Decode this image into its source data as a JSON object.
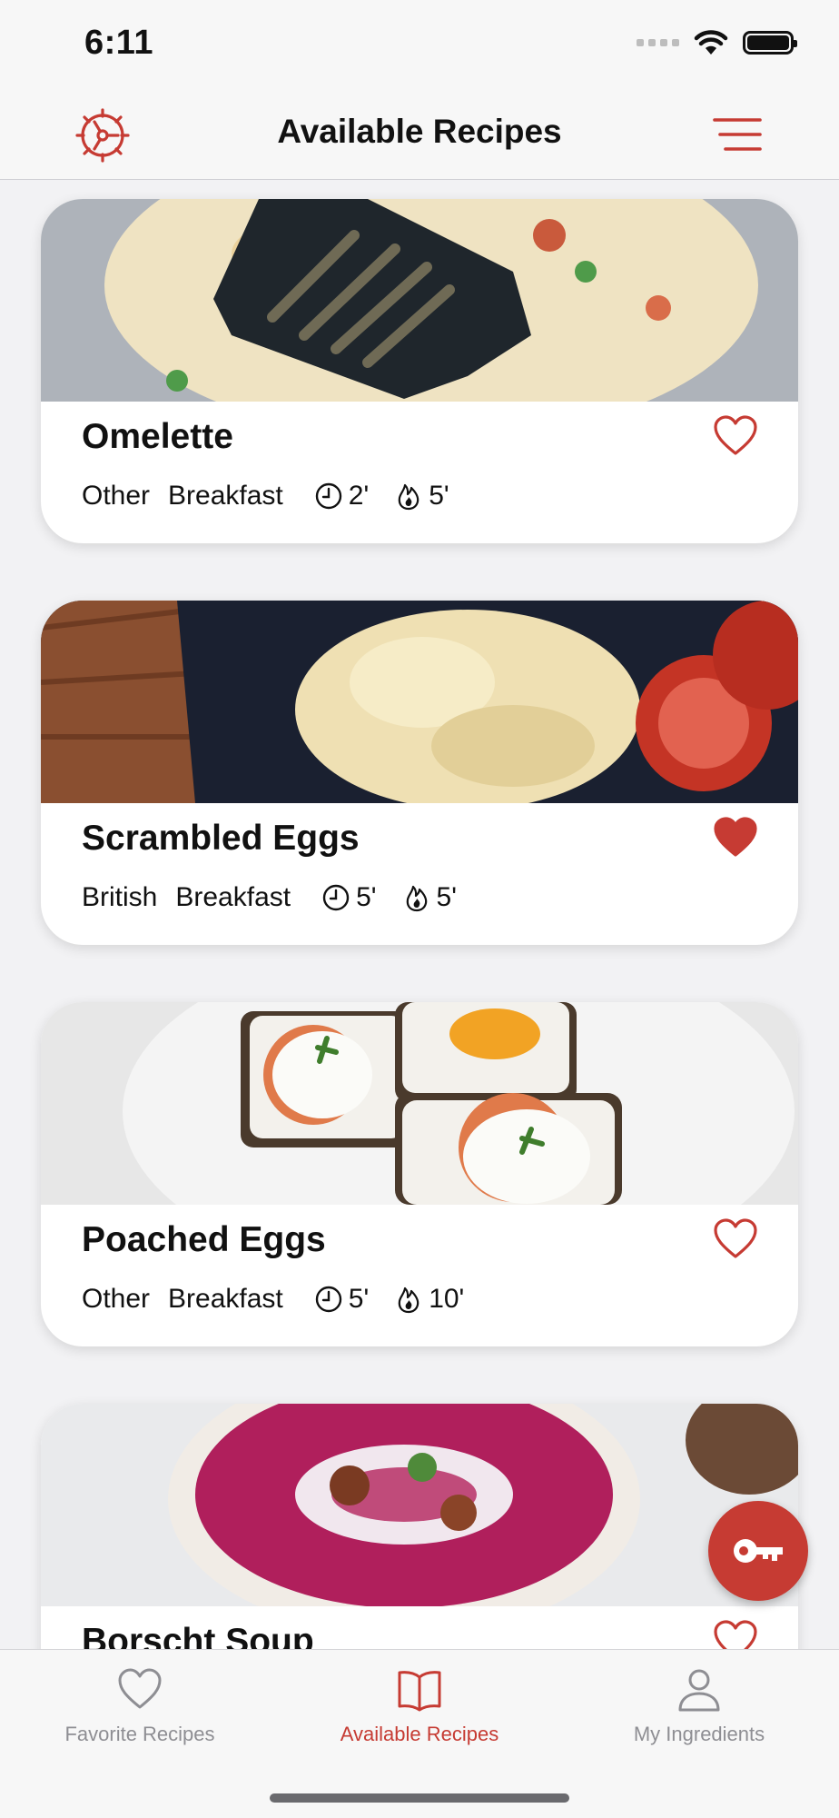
{
  "status_bar": {
    "time": "6:11"
  },
  "nav": {
    "title": "Available Recipes"
  },
  "colors": {
    "accent": "#c63b33",
    "inactive": "#8e8e93",
    "background": "#f2f2f4"
  },
  "recipes": [
    {
      "name": "Omelette",
      "cuisine": "Other",
      "meal": "Breakfast",
      "prep_time": "2'",
      "cook_time": "5'",
      "favorite": false,
      "image": "omelette"
    },
    {
      "name": "Scrambled Eggs",
      "cuisine": "British",
      "meal": "Breakfast",
      "prep_time": "5'",
      "cook_time": "5'",
      "favorite": true,
      "image": "scrambled-eggs"
    },
    {
      "name": "Poached Eggs",
      "cuisine": "Other",
      "meal": "Breakfast",
      "prep_time": "5'",
      "cook_time": "10'",
      "favorite": false,
      "image": "poached-eggs"
    },
    {
      "name": "Borscht Soup",
      "favorite": false,
      "image": "borscht-soup"
    }
  ],
  "fab": {
    "icon": "key-icon"
  },
  "tabs": [
    {
      "label": "Favorite Recipes",
      "icon": "heart-icon",
      "active": false
    },
    {
      "label": "Available Recipes",
      "icon": "book-icon",
      "active": true
    },
    {
      "label": "My Ingredients",
      "icon": "person-icon",
      "active": false
    }
  ]
}
